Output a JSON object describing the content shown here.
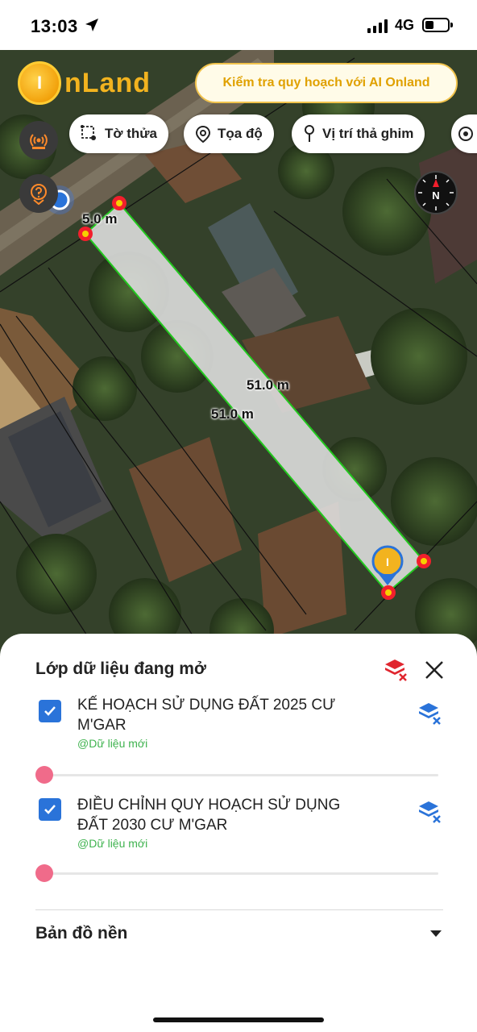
{
  "status_bar": {
    "time": "13:03",
    "network": "4G",
    "signal_bars": 4
  },
  "header": {
    "logo_mark": "I",
    "logo_text": "nLand",
    "ai_button_label": "Kiểm tra quy hoạch với AI Onland"
  },
  "toolbar": {
    "chips": [
      {
        "label": "Tờ thửa",
        "icon": "parcel-icon"
      },
      {
        "label": "Tọa độ",
        "icon": "location-pin-icon"
      },
      {
        "label": "Vị trí thả ghim",
        "icon": "pin-drop-icon"
      }
    ]
  },
  "map": {
    "measurements": {
      "short_edge": "5.0 m",
      "long_edge_right": "51.0 m",
      "long_edge_left": "51.0 m"
    },
    "compass_label": "N"
  },
  "sheet": {
    "title": "Lớp dữ liệu đang mở",
    "layers": [
      {
        "name": "KẾ HOẠCH SỬ DỤNG ĐẤT 2025 CƯ M'GAR",
        "source": "@Dữ liệu mới",
        "checked": true,
        "opacity": 0
      },
      {
        "name": "ĐIỀU CHỈNH QUY HOẠCH SỬ DỤNG ĐẤT 2030 CƯ M'GAR",
        "source": "@Dữ liệu mới",
        "checked": true,
        "opacity": 0
      }
    ],
    "basemap_label": "Bản đồ nền"
  },
  "colors": {
    "accent_gold": "#f2b31f",
    "checkbox_blue": "#2a73d9",
    "slider_pink": "#f06b8a",
    "source_green": "#3fb34f",
    "parcel_outline": "#22c81e"
  }
}
